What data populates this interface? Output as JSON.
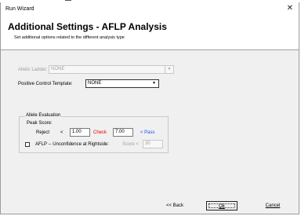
{
  "window": {
    "title": "Run Wizard",
    "close_glyph": "✕"
  },
  "header": {
    "title": "Additional Settings - AFLP Analysis",
    "subtitle": "Set additional options related to the different analysis type"
  },
  "allelic_ladder": {
    "label": "Allelic Ladder:",
    "value": "NONE",
    "enabled": false
  },
  "positive_control": {
    "label": "Positive Control Template:",
    "value": "NONE"
  },
  "allele_evaluation": {
    "group_label": "Allele Evaluation",
    "peak_score_label": "Peak Score:",
    "reject_label": "Reject",
    "lt1": "<",
    "reject_value": "1.00",
    "check_label": "Check",
    "check_value": "7.00",
    "pass_label": "< Pass",
    "rightside_label": "AFLP -- Unconfidence at Rightside:",
    "score_label": "Score <",
    "score_value": "30",
    "rightside_checked": false
  },
  "buttons": {
    "back": "<< Back",
    "ok": "Ok",
    "cancel": "Cancel"
  },
  "colors": {
    "reject": "#e00000",
    "pass": "#1e50e0"
  },
  "icons": {
    "dropdown": "chevron-down-icon",
    "close": "close-icon"
  }
}
